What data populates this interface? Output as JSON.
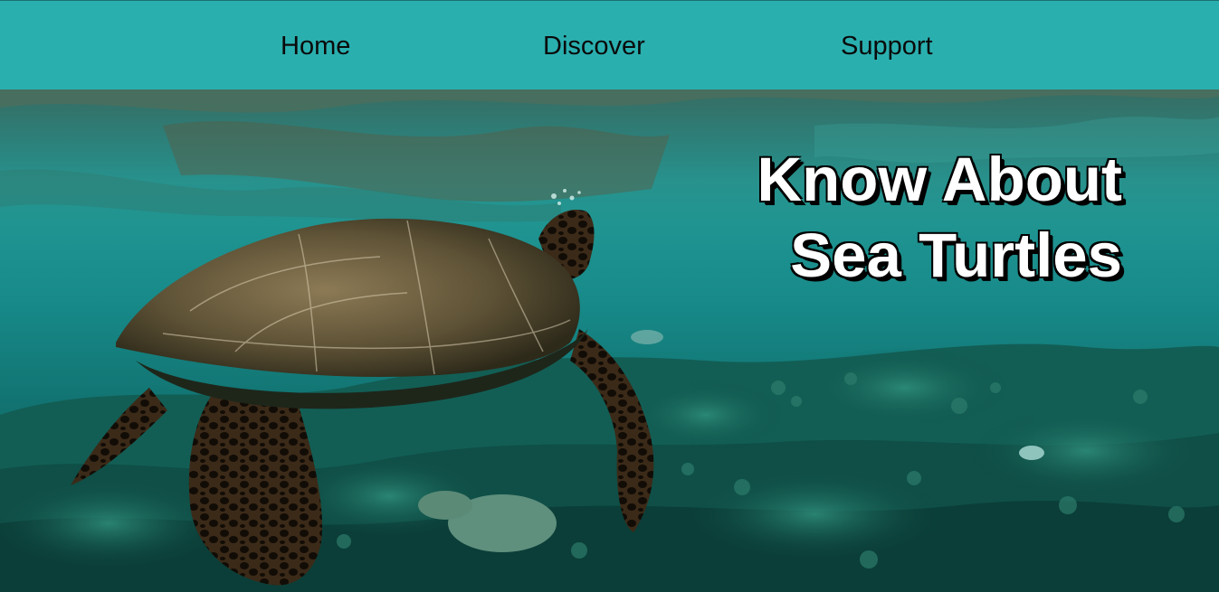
{
  "nav": {
    "items": [
      {
        "label": "Home"
      },
      {
        "label": "Discover"
      },
      {
        "label": "Support"
      }
    ]
  },
  "hero": {
    "title_line1": "Know About",
    "title_line2": "Sea Turtles",
    "image_subject": "sea turtle swimming over coral reef"
  },
  "colors": {
    "nav_background": "#2aafaf",
    "nav_text": "#0a0a0a",
    "title_text": "#ffffff",
    "title_shadow": "#000000"
  }
}
